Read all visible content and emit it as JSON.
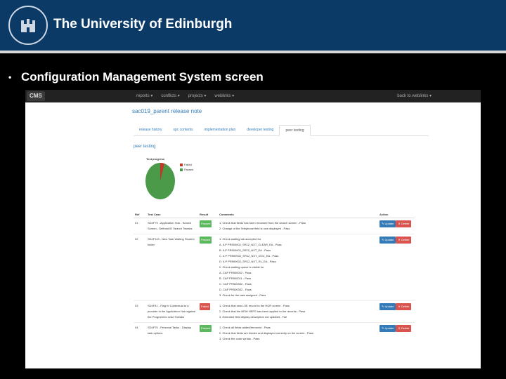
{
  "slide": {
    "university_name": "The University of Edinburgh",
    "bullet": "•",
    "heading": "Configuration Management System screen"
  },
  "app": {
    "brand": "CMS",
    "nav": [
      "reports ▾",
      "conflicts ▾",
      "projects ▾",
      "weblinks ▾"
    ],
    "nav_right": "back to weblinks ▾",
    "page_title": "sac019_parent release note",
    "tabs": [
      "release history",
      "spc contents",
      "implementation plan",
      "developer testing",
      "peer testing"
    ],
    "active_tab": 4,
    "section_title": "peer testing",
    "chart_title": "Test progress",
    "legend": [
      {
        "label": "Failed",
        "color": "#c0392b"
      },
      {
        "label": "Passed",
        "color": "#4a9a4a"
      }
    ],
    "columns": [
      "Ref",
      "Test Case",
      "Result",
      "Comments",
      "Action"
    ],
    "update_label": "✎ Update",
    "delete_label": "✕ Delete",
    "rows": [
      {
        "ref": "01",
        "test_case": "SD4F79 - Application Hub - Search Screen - Defined ID Search Tweaks",
        "result": "Passed",
        "comments": [
          "1. Check that fields has been renamed from the search screen - Pass",
          "2. Change of the Telephone field is now displayed - Pass"
        ]
      },
      {
        "ref": "02",
        "test_case": "SD4F113 - New Task Waiting Student folder",
        "result": "Passed",
        "comments": [
          "1. Check waiting tab accepted for",
          "A. ILP PR500002_SR12_NXT_CLEAR_EA - Pass",
          "B. ILP PR500002_SR12_NXT_EA - Pass",
          "C. ILP PR500002_SR12_NXT_DOC_EA - Pass",
          "D. ILP PR500002_SR12_NXT_RL_EA - Pass",
          "2. Check waiting queue is visible for",
          "A. CAP PR500002 - Pass",
          "B. CAP PR500011 - Pass",
          "C. CAP PR500002 - Pass",
          "D. CAP PR500002 - Pass",
          "3. Check for the task assigned - Pass"
        ]
      },
      {
        "ref": "03",
        "test_case": "SD4F41 - Flag to Contextual to a provider in the Application Hub against the Programme Lead Tweaks",
        "result": "Failed",
        "comments": [
          "1. Check that new LSE record to the HOR screen - Pass",
          "2. Check that the NEW HEPS has been applied to the records - Pass",
          "3. Extended field display description not updated - Fail"
        ]
      },
      {
        "ref": "04",
        "test_case": "SD4F70 - Personal Tasks - Display task options",
        "result": "Passed",
        "comments": [
          "1. Check all fields added/removed - Pass",
          "2. Check that fields are hidden and displayed correctly on the screen - Pass",
          "3. Check the code syntax - Pass"
        ]
      }
    ]
  }
}
